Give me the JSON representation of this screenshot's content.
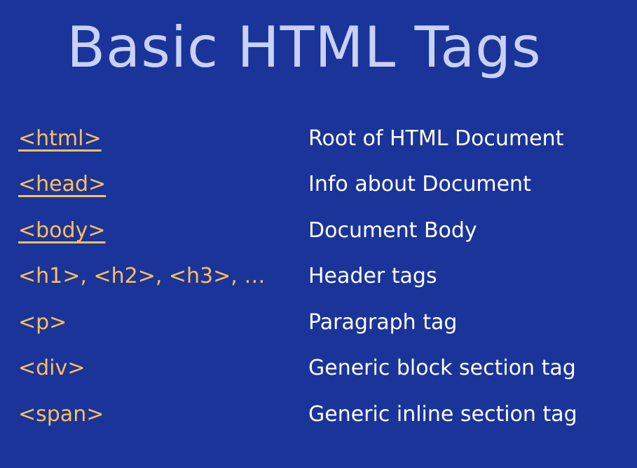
{
  "slide": {
    "title": "Basic HTML Tags"
  },
  "colors": {
    "background": "#1a349a",
    "title": "#c8d2f6",
    "tag": "#ffbf5a",
    "description": "#ffffff"
  },
  "rows": [
    {
      "tag": "<html>",
      "description": "Root of HTML Document"
    },
    {
      "tag": "<head>",
      "description": "Info about Document"
    },
    {
      "tag": "<body>",
      "description": "Document Body"
    },
    {
      "tag": "<h1>, <h2>, <h3>, …",
      "description": "Header tags"
    },
    {
      "tag": "<p>",
      "description": "Paragraph tag"
    },
    {
      "tag": "<div>",
      "description": "Generic block section tag"
    },
    {
      "tag": "<span>",
      "description": "Generic inline section tag"
    }
  ]
}
